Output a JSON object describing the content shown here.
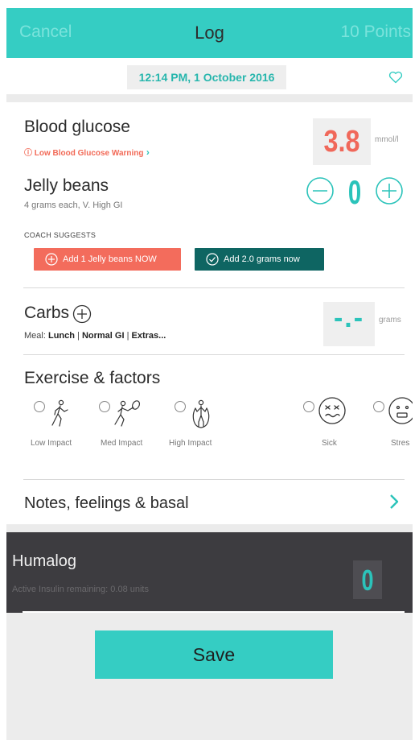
{
  "header": {
    "cancel_label": "Cancel",
    "title": "Log",
    "points_label": "10 Points"
  },
  "datetime": "12:14 PM, 1 October 2016",
  "blood_glucose": {
    "label": "Blood glucose",
    "warning": "Low Blood Glucose Warning",
    "value": "3.8",
    "unit": "mmol/l"
  },
  "jelly": {
    "label": "Jelly beans",
    "subtitle": "4 grams each, V. High GI",
    "quantity": "0"
  },
  "coach": {
    "heading": "COACH SUGGESTS",
    "primary": "Add 1 Jelly beans NOW",
    "secondary": "Add 2.0 grams now"
  },
  "carbs": {
    "label": "Carbs",
    "value": "-.-",
    "unit": "grams",
    "meal_prefix": "Meal: ",
    "meal_type": "Lunch",
    "gi": "Normal GI",
    "extras": "Extras..."
  },
  "exercise": {
    "title": "Exercise & factors",
    "items": [
      {
        "label": "Low Impact",
        "icon": "walking-icon"
      },
      {
        "label": "Med Impact",
        "icon": "tennis-icon"
      },
      {
        "label": "High Impact",
        "icon": "jump-rope-icon"
      },
      {
        "label": "Sick",
        "icon": "sick-face-icon"
      },
      {
        "label": "Stres",
        "icon": "stressed-face-icon"
      }
    ]
  },
  "notes_label": "Notes, feelings & basal",
  "insulin": {
    "name": "Humalog",
    "active_text": "Active Insulin remaining: 0.08 units",
    "value": "0"
  },
  "save_label": "Save",
  "colors": {
    "teal": "#35cdc3",
    "warning": "#f26a57",
    "dark_button": "#0e6562",
    "panel": "#3d3c40"
  }
}
